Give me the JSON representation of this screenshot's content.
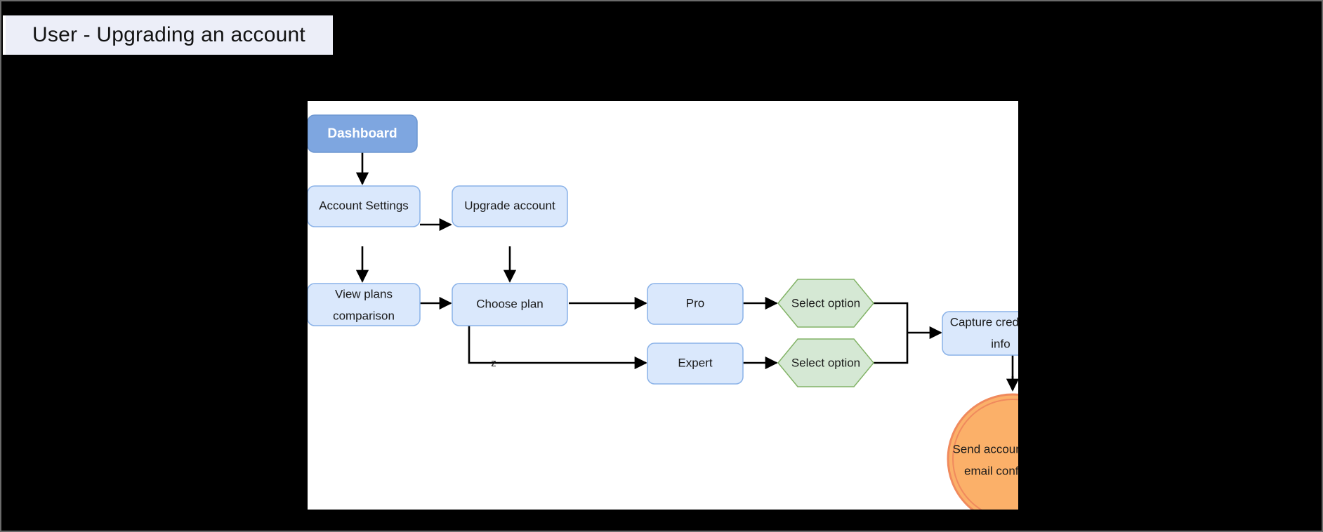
{
  "window": {
    "title": "User - Upgrading an account",
    "title_chip_bg": "#eceef8",
    "page_bg": "#000000",
    "canvas_bg": "#ffffff"
  },
  "palette": {
    "node_blue_fill": "#dae8fc",
    "node_blue_stroke": "#8ab2e8",
    "start_blue_fill": "#7ea6e0",
    "start_blue_stroke": "#6c96d0",
    "hex_green_fill": "#d5e8d4",
    "hex_green_stroke": "#82b366",
    "end_orange_fill": "#fbb069",
    "end_orange_stroke": "#f08a5d",
    "edge_black": "#000000",
    "text_dark": "#1a1a1a",
    "text_light": "#ffffff"
  },
  "diagram": {
    "type": "flowchart",
    "title": "User - Upgrading an account",
    "nodes": [
      {
        "id": "dashboard",
        "label": "Dashboard",
        "shape": "rounded-rect",
        "style": "start"
      },
      {
        "id": "account",
        "label": "Account Settings",
        "shape": "rounded-rect",
        "style": "process"
      },
      {
        "id": "upgrade",
        "label": "Upgrade account",
        "shape": "rounded-rect",
        "style": "process"
      },
      {
        "id": "viewplans1",
        "label": "View plans",
        "shape": "rounded-rect",
        "style": "process"
      },
      {
        "id": "viewplans2",
        "label": "comparison",
        "shape": "rounded-rect",
        "style": "process"
      },
      {
        "id": "chooseplan",
        "label": "Choose plan",
        "shape": "rounded-rect",
        "style": "process"
      },
      {
        "id": "pro",
        "label": "Pro",
        "shape": "rounded-rect",
        "style": "process"
      },
      {
        "id": "expert",
        "label": "Expert",
        "shape": "rounded-rect",
        "style": "process"
      },
      {
        "id": "selectpro",
        "label": "Select option",
        "shape": "hexagon",
        "style": "decision"
      },
      {
        "id": "selectexp",
        "label": "Select option",
        "shape": "hexagon",
        "style": "decision"
      },
      {
        "id": "capture1",
        "label": "Capture credit card",
        "shape": "rounded-rect",
        "style": "process"
      },
      {
        "id": "capture2",
        "label": "info",
        "shape": "rounded-rect",
        "style": "process"
      },
      {
        "id": "send1",
        "label": "Send account upgrade",
        "shape": "circle",
        "style": "end"
      },
      {
        "id": "send2",
        "label": "email confirmation",
        "shape": "circle",
        "style": "end"
      }
    ],
    "edges": [
      {
        "from": "dashboard",
        "to": "account",
        "label": ""
      },
      {
        "from": "account",
        "to": "upgrade",
        "label": ""
      },
      {
        "from": "account",
        "to": "viewplans",
        "label": ""
      },
      {
        "from": "upgrade",
        "to": "chooseplan",
        "label": ""
      },
      {
        "from": "viewplans",
        "to": "chooseplan",
        "label": ""
      },
      {
        "from": "chooseplan",
        "to": "pro",
        "label": ""
      },
      {
        "from": "chooseplan",
        "to": "expert",
        "label": "z"
      },
      {
        "from": "pro",
        "to": "selectpro",
        "label": ""
      },
      {
        "from": "expert",
        "to": "selectexp",
        "label": ""
      },
      {
        "from": "selectpro",
        "to": "capture",
        "label": ""
      },
      {
        "from": "selectexp",
        "to": "capture",
        "label": ""
      },
      {
        "from": "capture",
        "to": "send",
        "label": ""
      }
    ],
    "edge_label_z": "z"
  }
}
